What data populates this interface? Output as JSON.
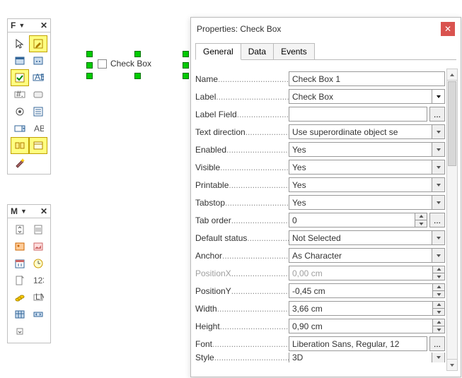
{
  "panelF": {
    "title": "F"
  },
  "panelM": {
    "title": "M"
  },
  "canvas": {
    "checkbox_label": "Check Box"
  },
  "dialog": {
    "title": "Properties: Check Box",
    "tabs": [
      "General",
      "Data",
      "Events"
    ],
    "activeTab": 0,
    "ellipsis": "...",
    "fields": [
      {
        "label": "Name",
        "type": "text",
        "value": "Check Box 1"
      },
      {
        "label": "Label",
        "type": "combo",
        "value": "Check Box"
      },
      {
        "label": "Label Field",
        "type": "text",
        "value": "",
        "ell": true
      },
      {
        "label": "Text direction",
        "type": "select",
        "value": "Use superordinate object se"
      },
      {
        "label": "Enabled",
        "type": "select",
        "value": "Yes"
      },
      {
        "label": "Visible",
        "type": "select",
        "value": "Yes"
      },
      {
        "label": "Printable",
        "type": "select",
        "value": "Yes"
      },
      {
        "label": "Tabstop",
        "type": "select",
        "value": "Yes"
      },
      {
        "label": "Tab order",
        "type": "spin",
        "value": "0",
        "ell": true
      },
      {
        "label": "Default status",
        "type": "select",
        "value": "Not Selected"
      },
      {
        "label": "Anchor",
        "type": "select",
        "value": "As Character"
      },
      {
        "label": "PositionX",
        "type": "spin",
        "value": "0,00 cm",
        "disabled": true
      },
      {
        "label": "PositionY",
        "type": "spin",
        "value": "-0,45 cm"
      },
      {
        "label": "Width",
        "type": "spin",
        "value": "3,66 cm"
      },
      {
        "label": "Height",
        "type": "spin",
        "value": "0,90 cm"
      },
      {
        "label": "Font",
        "type": "text",
        "value": "Liberation Sans, Regular, 12",
        "ell": true
      },
      {
        "label": "Style",
        "type": "select",
        "value": "3D",
        "cut": true
      }
    ]
  }
}
